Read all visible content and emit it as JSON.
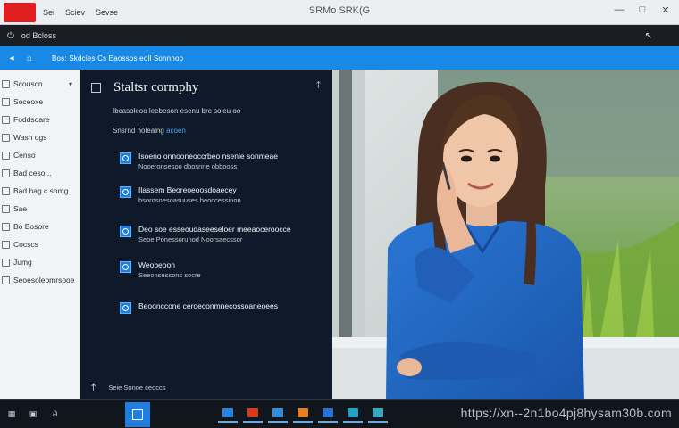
{
  "titlebar": {
    "menus": [
      "Sei",
      "Sciev",
      "Sevse"
    ],
    "title": "SRMo SRK(G",
    "controls": {
      "minimize": "—",
      "maximize": "□",
      "close": "✕"
    }
  },
  "menustrip": {
    "label": "od Bcloss",
    "right_icon": "cursor-icon"
  },
  "addressbar": {
    "text": "Bos: Skdcies Cs Eaossos eoll Sonnnoo"
  },
  "sidebar": {
    "items": [
      {
        "label": "Scouscn",
        "has_chevron": true
      },
      {
        "label": "Soceoxe"
      },
      {
        "label": "Foddsoare"
      },
      {
        "label": "Wash ogs"
      },
      {
        "label": "Censo"
      },
      {
        "label": "Bad ceso..."
      },
      {
        "label": "Bad hag c snmg"
      },
      {
        "label": "Sae"
      },
      {
        "label": "Bo Bosore"
      },
      {
        "label": "Cocscs"
      },
      {
        "label": "Jumg"
      },
      {
        "label": "Seoesoleomrsooe"
      }
    ]
  },
  "panel": {
    "title": "Staltsr cormphy",
    "description": "Ibcasoleoo leebeson esenu brc soieu oo",
    "subtitle": "Snsrnd holealng",
    "subtitle_link": "acoen",
    "options": [
      {
        "line1": "Isoeno onnooneoccrbeo nsenle sonmeae",
        "line2": "Nooeronsesoo dbosnne obbooss"
      },
      {
        "line1": "Ilassem Beoreoeoosdoaecey",
        "line2": "bsorosoesoasuuses beoccessinon"
      },
      {
        "line1": "Deo soe esseoudaseeseloer meeaoceroocce",
        "line2": "Seoe Ponessorunod Noorsaecssor"
      },
      {
        "line1": "Weobeoon",
        "line2": "Seeonsessons socre"
      },
      {
        "line1": "Beoonccone ceroeconmnecossoaneoees",
        "line2": ""
      }
    ],
    "footer": "Seie Sonoe ceoccs"
  },
  "taskbar": {
    "left_icons": [
      "grid-icon",
      "terminal-icon",
      "text-icon"
    ],
    "apps": [
      {
        "name": "mail-app",
        "color": "#2a82e0"
      },
      {
        "name": "video-app",
        "color": "#d83a1e"
      },
      {
        "name": "calendar-app",
        "color": "#2f8fdc"
      },
      {
        "name": "office-app",
        "color": "#e67e22"
      },
      {
        "name": "store-app",
        "color": "#2574d4"
      },
      {
        "name": "photos-app",
        "color": "#22a0c8"
      },
      {
        "name": "explorer-app",
        "color": "#3aa7c0"
      }
    ],
    "watermark": "https://xn--2n1bo4pj8hysam30b.com"
  }
}
